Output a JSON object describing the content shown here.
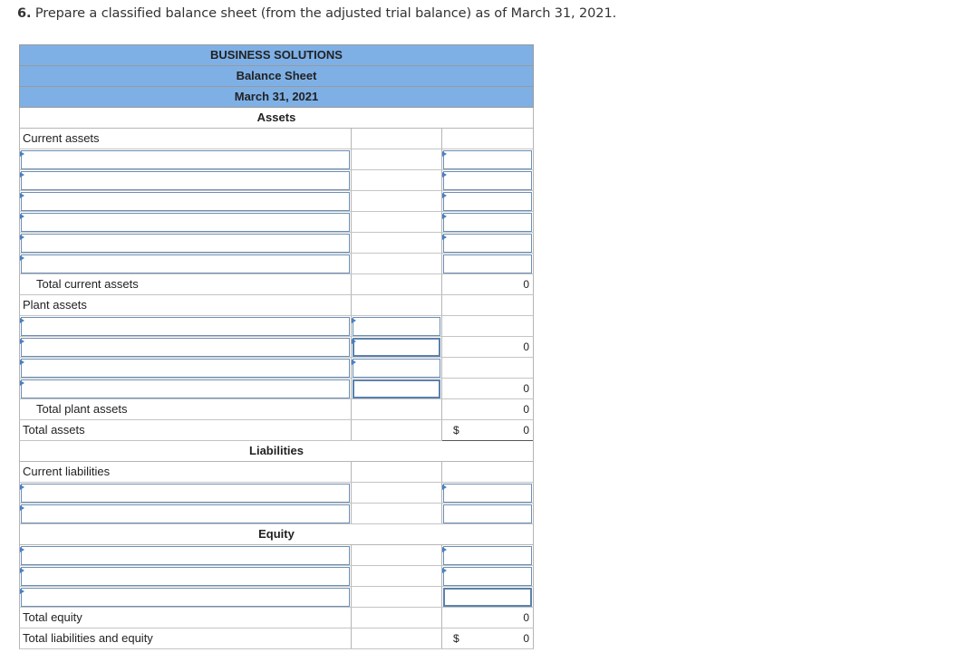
{
  "question": {
    "number": "6.",
    "text": "Prepare a classified balance sheet (from the adjusted trial balance) as of March 31, 2021."
  },
  "sheet": {
    "company": "BUSINESS SOLUTIONS",
    "statement": "Balance Sheet",
    "date": "March 31, 2021",
    "sections": {
      "assets": "Assets",
      "liabilities": "Liabilities",
      "equity": "Equity"
    },
    "labels": {
      "current_assets": "Current assets",
      "total_current_assets": "Total current assets",
      "plant_assets": "Plant assets",
      "total_plant_assets": "Total plant assets",
      "total_assets": "Total assets",
      "current_liabilities": "Current liabilities",
      "total_equity": "Total equity",
      "total_liabilities_equity": "Total liabilities and equity"
    },
    "values": {
      "total_current_assets": "0",
      "plant_row2": "0",
      "plant_row4": "0",
      "total_plant_assets": "0",
      "total_assets": "0",
      "total_equity": "0",
      "total_liabilities_equity": "0",
      "currency": "$"
    }
  },
  "colors": {
    "header_bg": "#7eb0e6",
    "input_border": "#6c8fb4",
    "marker": "#4a7fc0"
  }
}
